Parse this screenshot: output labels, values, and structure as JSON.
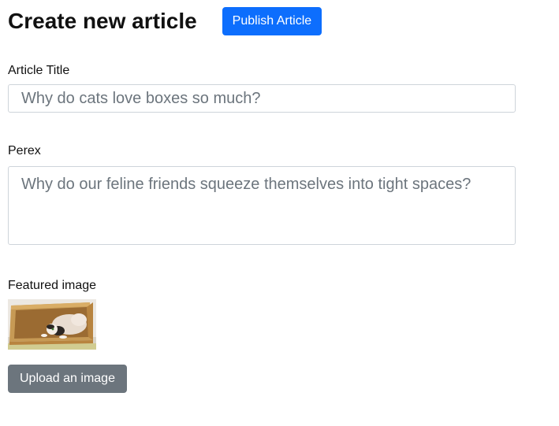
{
  "header": {
    "title": "Create new article",
    "publish_label": "Publish Article"
  },
  "form": {
    "title_label": "Article Title",
    "title_placeholder": "Why do cats love boxes so much?",
    "perex_label": "Perex",
    "perex_placeholder": "Why do our feline friends squeeze themselves into tight spaces?",
    "image_label": "Featured image",
    "upload_label": "Upload an image"
  },
  "colors": {
    "primary": "#0d6efd",
    "secondary": "#6c757d",
    "input_border": "#ced4da"
  }
}
